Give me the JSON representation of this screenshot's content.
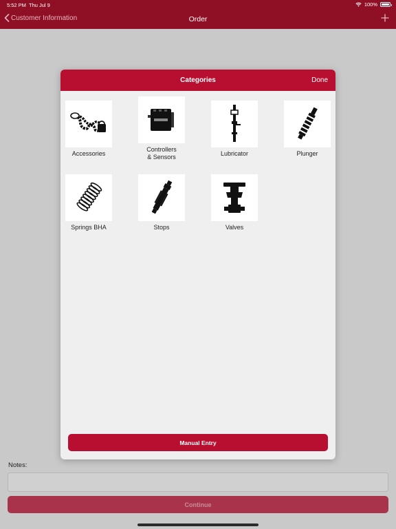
{
  "status": {
    "time": "5:52 PM",
    "date": "Thu Jul 9",
    "battery": "100%"
  },
  "nav": {
    "back_label": "Customer Information",
    "title": "Order"
  },
  "form": {
    "notes_label": "Notes:",
    "notes_value": "",
    "continue_label": "Continue"
  },
  "modal": {
    "title": "Categories",
    "done_label": "Done",
    "categories": [
      {
        "label": "Accessories",
        "icon": "chain-lock-icon"
      },
      {
        "label": "Controllers\n& Sensors",
        "icon": "controller-box-icon"
      },
      {
        "label": "Lubricator",
        "icon": "lubricator-icon"
      },
      {
        "label": "Plunger",
        "icon": "plunger-icon"
      },
      {
        "label": "Springs BHA",
        "icon": "spring-icon"
      },
      {
        "label": "Stops",
        "icon": "stop-tool-icon"
      },
      {
        "label": "Valves",
        "icon": "valve-icon"
      }
    ],
    "manual_entry_label": "Manual Entry"
  },
  "colors": {
    "nav_bar": "#8f0f24",
    "accent": "#b80e2f",
    "modal_bg": "#efefef",
    "dimmed_bg": "#c9c9c9"
  }
}
